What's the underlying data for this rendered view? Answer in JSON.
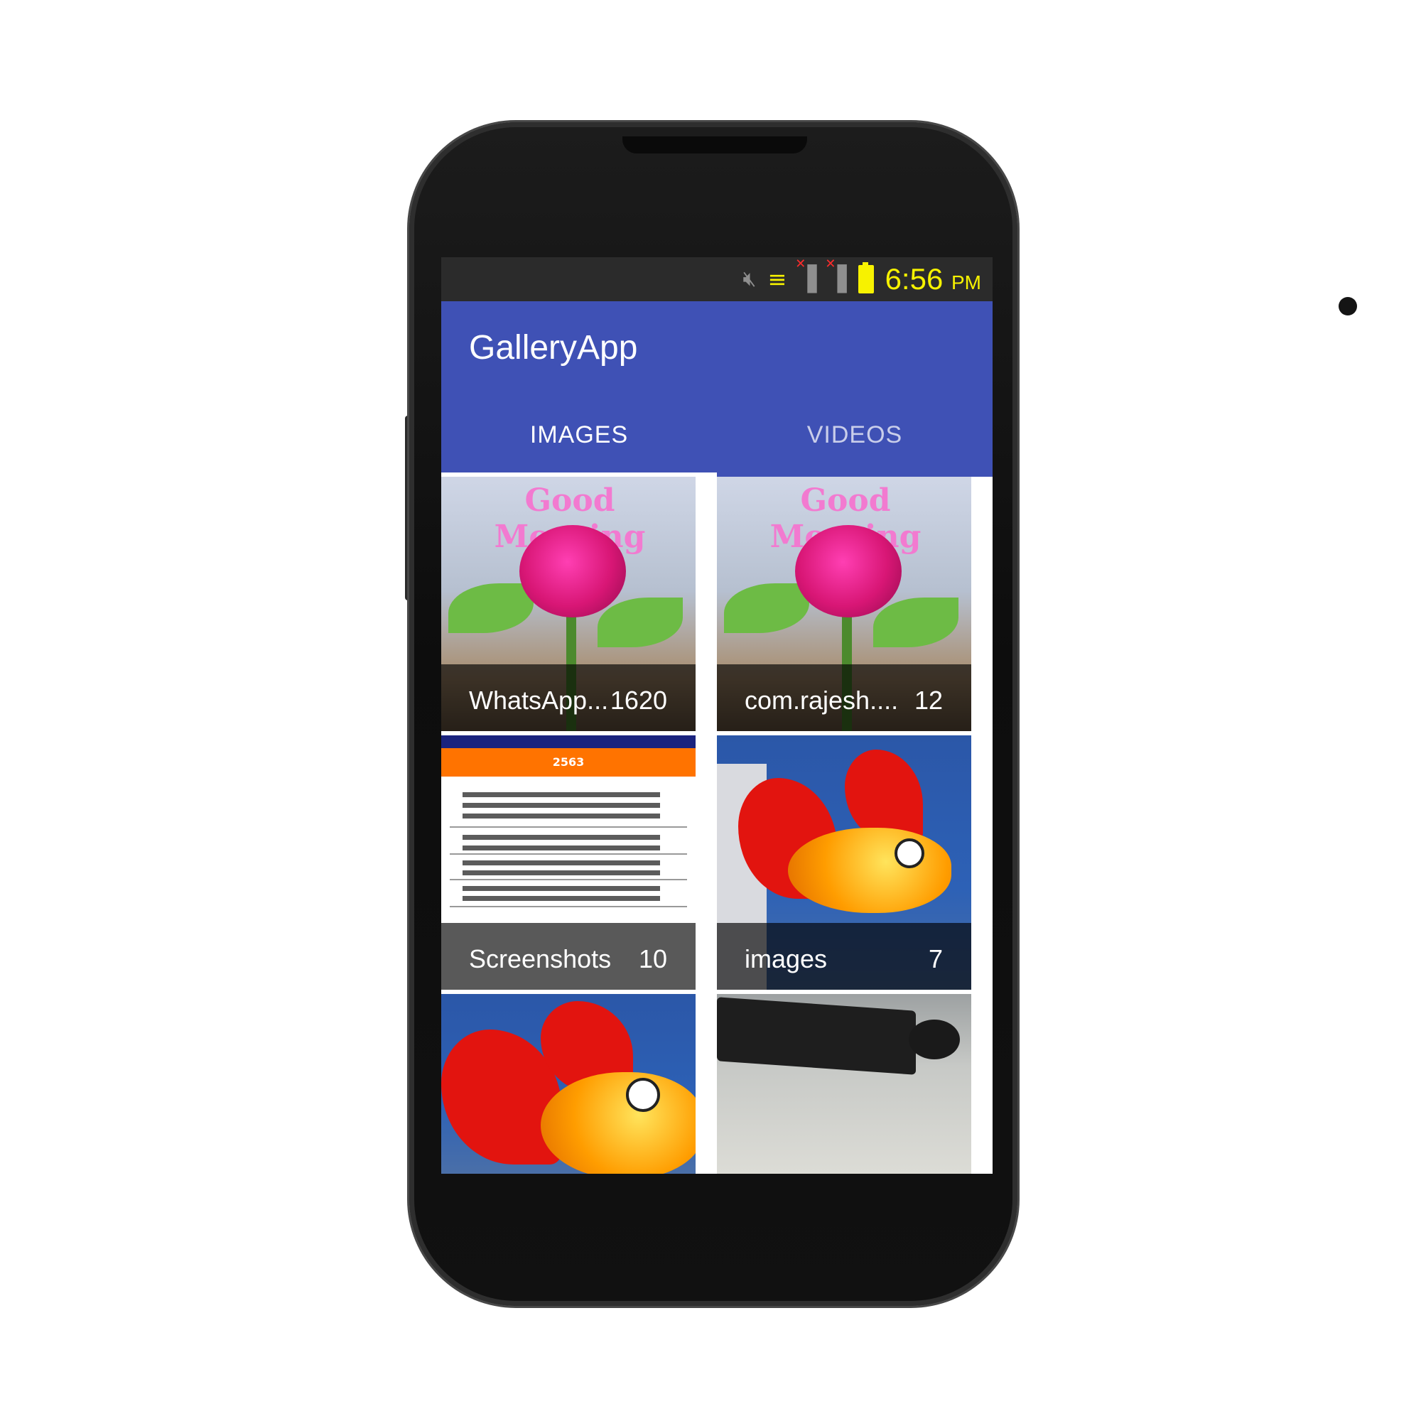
{
  "status_bar": {
    "time": "6:56",
    "ampm": "PM",
    "icons": [
      "mute-icon",
      "wifi-icon",
      "signal-icon",
      "signal-icon",
      "battery-icon"
    ],
    "colors": {
      "clock": "#f7f200",
      "bar": "#2b2b2b"
    }
  },
  "app": {
    "title": "GalleryApp",
    "primary_color": "#3f51b5"
  },
  "tabs": [
    {
      "label": "IMAGES",
      "selected": true
    },
    {
      "label": "VIDEOS",
      "selected": false
    }
  ],
  "albums": [
    {
      "name": "WhatsApp...",
      "count": "1620",
      "thumbnail": "rose-image",
      "thumbnail_text": "Good Morning"
    },
    {
      "name": "com.rajesh....",
      "count": "12",
      "thumbnail": "rose-image",
      "thumbnail_text": "Good Morning"
    },
    {
      "name": "Screenshots",
      "count": "10",
      "thumbnail": "screenshot-image",
      "thumbnail_text": "2563"
    },
    {
      "name": "images",
      "count": "7",
      "thumbnail": "fish-image"
    },
    {
      "name": "",
      "count": "",
      "thumbnail": "fish-image"
    },
    {
      "name": "",
      "count": "",
      "thumbnail": "keyboard-image"
    }
  ]
}
